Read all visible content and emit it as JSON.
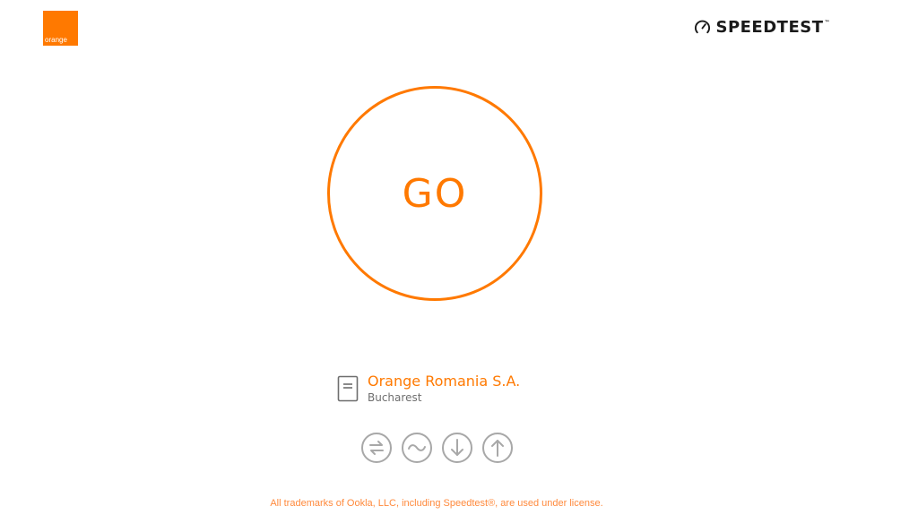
{
  "header": {
    "logo_text": "orange",
    "brand_text": "SPEEDTEST",
    "brand_tm": "™",
    "brand_icon": "gauge-icon"
  },
  "go_button": {
    "label": "GO"
  },
  "server": {
    "icon": "server-icon",
    "name": "Orange Romania S.A.",
    "location": "Bucharest"
  },
  "modes": [
    {
      "icon": "multi-connection-icon"
    },
    {
      "icon": "ping-wave-icon"
    },
    {
      "icon": "download-arrow-icon"
    },
    {
      "icon": "upload-arrow-icon"
    }
  ],
  "footer": {
    "text": "All trademarks of Ookla, LLC, including Speedtest®, are used under license."
  },
  "colors": {
    "accent": "#ff7900",
    "icon_gray": "#a8a8a8",
    "text_dark": "#1a1a1a"
  }
}
